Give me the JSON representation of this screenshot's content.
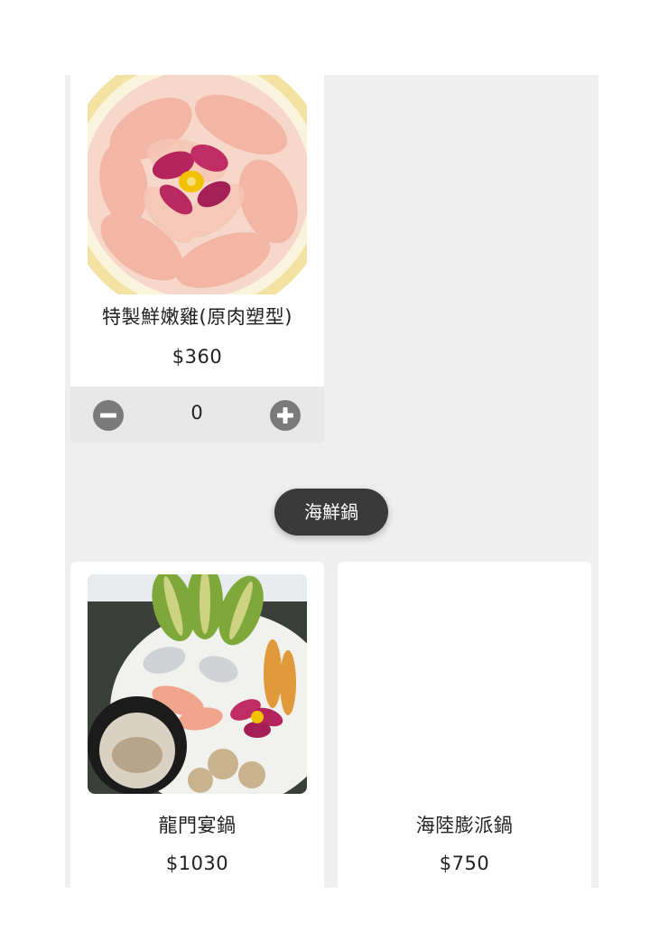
{
  "category": {
    "label": "海鮮鍋"
  },
  "products": [
    {
      "name": "特製鮮嫩雞(原肉塑型)",
      "price": "$360",
      "quantity": "0"
    },
    {
      "name": "龍門宴鍋",
      "price": "$1030"
    },
    {
      "name": "海陸膨派鍋",
      "price": "$750"
    }
  ],
  "icons": {
    "decrease": "minus-circle-icon",
    "increase": "plus-circle-icon"
  },
  "colors": {
    "panel_bg": "#efefef",
    "pill_bg": "#3a3a3a",
    "stepper_bg": "#e8e8e8",
    "stepper_icon": "#7a7a7a"
  }
}
